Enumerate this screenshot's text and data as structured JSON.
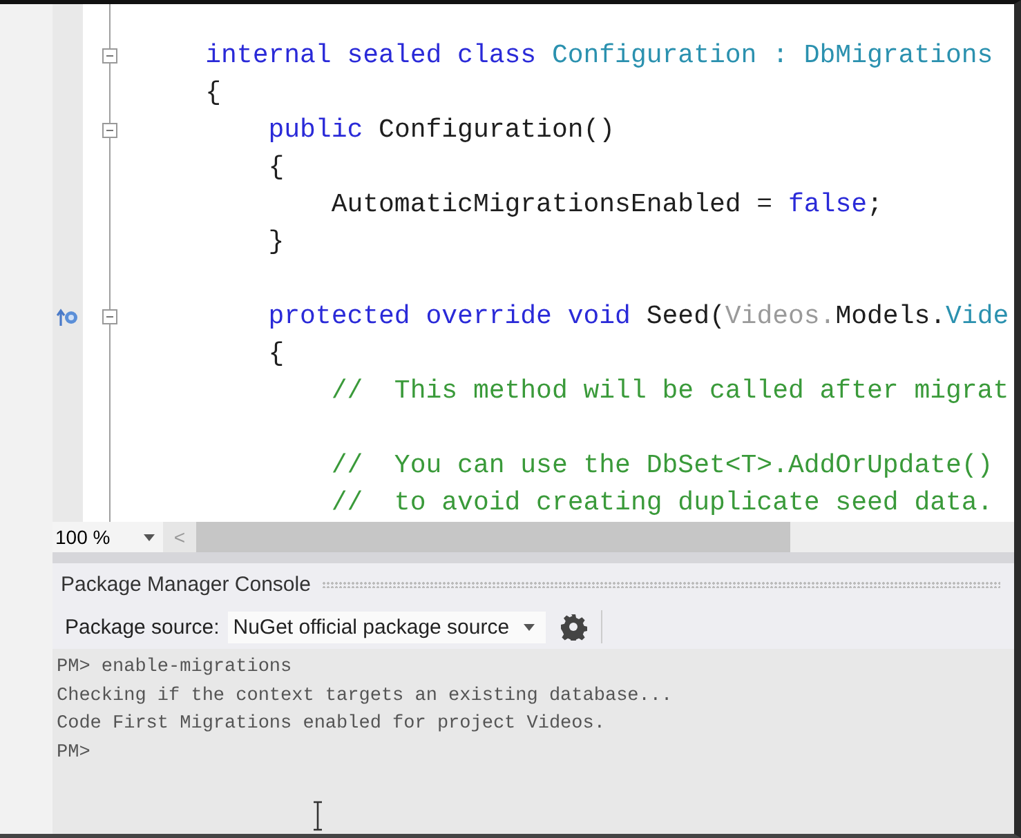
{
  "editor": {
    "lines": [
      {
        "fold": true,
        "marker": false,
        "segments": [
          {
            "kind": "keyword",
            "text": "    internal sealed class "
          },
          {
            "kind": "type",
            "text": "Configuration : DbMigrations"
          }
        ]
      },
      {
        "fold": false,
        "marker": false,
        "segments": [
          {
            "kind": "plain",
            "text": "    {"
          }
        ]
      },
      {
        "fold": true,
        "marker": false,
        "segments": [
          {
            "kind": "keyword",
            "text": "        public"
          },
          {
            "kind": "plain",
            "text": " Configuration()"
          }
        ]
      },
      {
        "fold": false,
        "marker": false,
        "segments": [
          {
            "kind": "plain",
            "text": "        {"
          }
        ]
      },
      {
        "fold": false,
        "marker": false,
        "segments": [
          {
            "kind": "plain",
            "text": "            AutomaticMigrationsEnabled = "
          },
          {
            "kind": "keyword",
            "text": "false"
          },
          {
            "kind": "plain",
            "text": ";"
          }
        ]
      },
      {
        "fold": false,
        "marker": false,
        "segments": [
          {
            "kind": "plain",
            "text": "        }"
          }
        ]
      },
      {
        "fold": false,
        "marker": false
      },
      {
        "fold": true,
        "marker": true,
        "segments": [
          {
            "kind": "keyword",
            "text": "        protected override void"
          },
          {
            "kind": "plain",
            "text": " Seed("
          },
          {
            "kind": "dim",
            "text": "Videos."
          },
          {
            "kind": "plain",
            "text": "Models."
          },
          {
            "kind": "type",
            "text": "Vide"
          }
        ]
      },
      {
        "fold": false,
        "marker": false,
        "segments": [
          {
            "kind": "plain",
            "text": "        {"
          }
        ]
      },
      {
        "fold": false,
        "marker": false,
        "segments": [
          {
            "kind": "comment",
            "text": "            //  This method will be called after migrat"
          }
        ]
      },
      {
        "fold": false,
        "marker": false
      },
      {
        "fold": false,
        "marker": false,
        "segments": [
          {
            "kind": "comment",
            "text": "            //  You can use the DbSet<T>.AddOrUpdate()"
          }
        ]
      },
      {
        "fold": false,
        "marker": false,
        "segments": [
          {
            "kind": "comment",
            "text": "            //  to avoid creating duplicate seed data."
          }
        ]
      }
    ]
  },
  "zoom": {
    "value": "100 %",
    "scroll_left": "<"
  },
  "panel": {
    "title": "Package Manager Console",
    "source_label": "Package source:",
    "source_value": "NuGet official package source"
  },
  "console": {
    "lines": [
      "PM> enable-migrations",
      "Checking if the context targets an existing database...",
      "Code First Migrations enabled for project Videos.",
      "PM>"
    ]
  }
}
